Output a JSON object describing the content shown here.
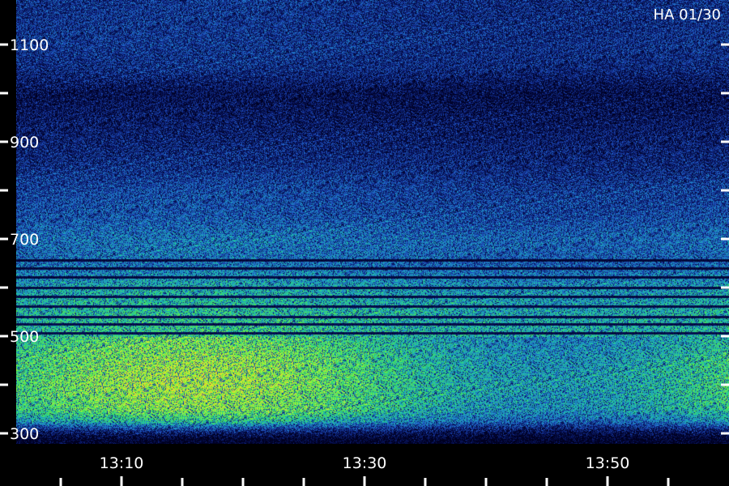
{
  "chart_data": {
    "type": "heatmap",
    "title": "",
    "corner_label": "HA 01/30",
    "xlabel": "",
    "ylabel": "",
    "y_ticks": [
      {
        "value": 300,
        "label": "300"
      },
      {
        "value": 400,
        "label": ""
      },
      {
        "value": 500,
        "label": "500"
      },
      {
        "value": 600,
        "label": ""
      },
      {
        "value": 700,
        "label": "700"
      },
      {
        "value": 800,
        "label": ""
      },
      {
        "value": 900,
        "label": "900"
      },
      {
        "value": 1000,
        "label": ""
      },
      {
        "value": 1100,
        "label": "1100"
      },
      {
        "value": 1200,
        "label": ""
      }
    ],
    "ylim": [
      300,
      1100
    ],
    "x_ticks": [
      {
        "value": "13:10",
        "label": "13:10"
      },
      {
        "value": "13:30",
        "label": "13:30"
      },
      {
        "value": "13:50",
        "label": "13:50"
      }
    ],
    "xlim": [
      "13:02",
      "13:58"
    ],
    "colormap": [
      "#000020",
      "#0a1a6e",
      "#1f4fbf",
      "#1e90c8",
      "#1fc8a0",
      "#4ee84a",
      "#b8f23a",
      "#ffd21f"
    ],
    "intensity_profile": [
      {
        "y": 300,
        "level": 0.35
      },
      {
        "y": 350,
        "level": 0.7
      },
      {
        "y": 400,
        "level": 0.75
      },
      {
        "y": 450,
        "level": 0.72
      },
      {
        "y": 500,
        "level": 0.65
      },
      {
        "y": 550,
        "level": 0.62
      },
      {
        "y": 600,
        "level": 0.55
      },
      {
        "y": 650,
        "level": 0.4
      },
      {
        "y": 700,
        "level": 0.42
      },
      {
        "y": 750,
        "level": 0.33
      },
      {
        "y": 800,
        "level": 0.3
      },
      {
        "y": 850,
        "level": 0.22
      },
      {
        "y": 900,
        "level": 0.18
      },
      {
        "y": 950,
        "level": 0.14
      },
      {
        "y": 1000,
        "level": 0.1
      },
      {
        "y": 1050,
        "level": 0.22
      },
      {
        "y": 1100,
        "level": 0.25
      },
      {
        "y": 1150,
        "level": 0.24
      }
    ],
    "dark_lines_y": [
      507,
      525,
      540,
      562,
      582,
      600,
      622,
      640,
      656
    ],
    "grid": false,
    "legend": "none"
  }
}
